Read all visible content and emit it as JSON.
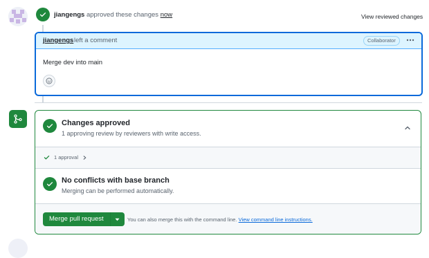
{
  "review_event": {
    "user": "jiangengs",
    "action": "approved these changes",
    "time": "now",
    "view_reviewed": "View reviewed changes"
  },
  "comment": {
    "author": "jiangengs",
    "action": "left a comment",
    "role_badge": "Collaborator",
    "body": "Merge dev into main"
  },
  "merge_box": {
    "approval": {
      "title": "Changes approved",
      "subtitle": "1 approving review by reviewers with write access."
    },
    "approvals_count": "1 approval",
    "conflicts": {
      "title": "No conflicts with base branch",
      "subtitle": "Merging can be performed automatically."
    },
    "merge_button": "Merge pull request",
    "alt_text": "You can also merge this with the command line.",
    "alt_link": "View command line instructions."
  },
  "colors": {
    "success": "#1f883d",
    "accent": "#0969da",
    "header_bg": "#ddf4ff"
  },
  "icons": [
    "check-icon",
    "kebab-icon",
    "smiley-icon",
    "git-merge-icon",
    "chevron-up-icon",
    "chevron-right-icon",
    "triangle-down-icon"
  ]
}
